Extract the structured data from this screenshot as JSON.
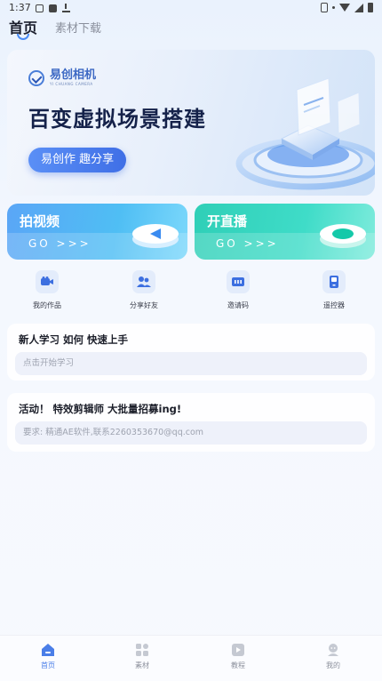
{
  "status_bar": {
    "time": "1:37"
  },
  "top_tabs": [
    {
      "label": "首页",
      "active": true
    },
    {
      "label": "素材下载",
      "active": false
    }
  ],
  "banner": {
    "logo_text": "易创相机",
    "logo_sub": "YI CHUANG CAMERA",
    "headline": "百变虚拟场景搭建",
    "pill": "易创作 趣分享"
  },
  "feature_cards": [
    {
      "title": "拍视频",
      "go": "GO >>>",
      "color": "#5aa6f6"
    },
    {
      "title": "开直播",
      "go": "GO >>>",
      "color": "#2fcfb7"
    }
  ],
  "quick_actions": [
    {
      "label": "我的作品",
      "icon": "video-camera-icon"
    },
    {
      "label": "分享好友",
      "icon": "share-friends-icon"
    },
    {
      "label": "邀请码",
      "icon": "invite-code-icon"
    },
    {
      "label": "遥控器",
      "icon": "remote-control-icon"
    }
  ],
  "info_cards": [
    {
      "title": "新人学习 如何 快速上手",
      "field": "点击开始学习"
    },
    {
      "title": "活动！ 特效剪辑师 大批量招募ing!",
      "field": "要求: 精通AE软件,联系2260353670@qq.com"
    }
  ],
  "bottom_nav": [
    {
      "label": "首页",
      "icon": "home-icon",
      "active": true
    },
    {
      "label": "素材",
      "icon": "material-icon",
      "active": false
    },
    {
      "label": "教程",
      "icon": "tutorial-icon",
      "active": false
    },
    {
      "label": "我的",
      "icon": "profile-icon",
      "active": false
    }
  ],
  "colors": {
    "accent": "#4a7ee8",
    "video_card": "#5aa6f6",
    "live_card": "#2fcfb7"
  }
}
